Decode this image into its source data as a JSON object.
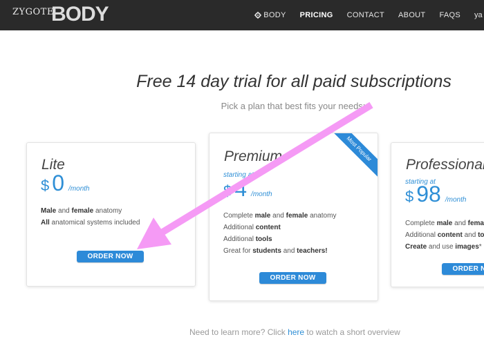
{
  "nav": {
    "logo_zygote": "ZYGOTE",
    "logo_body": "BODY",
    "items": [
      {
        "label": "BODY",
        "icon": "gear-icon"
      },
      {
        "label": "PRICING",
        "active": true
      },
      {
        "label": "CONTACT"
      },
      {
        "label": "ABOUT"
      },
      {
        "label": "FAQS"
      }
    ],
    "user_partial": "ya"
  },
  "headline": "Free 14 day trial for all paid subscriptions",
  "subline": "Pick a plan that best fits your needs:",
  "plans": [
    {
      "name": "Lite",
      "currency": "$",
      "amount": "0",
      "period": "/month",
      "features": [
        [
          {
            "b": "Male"
          },
          {
            "t": " and "
          },
          {
            "b": "female"
          },
          {
            "t": " anatomy"
          }
        ],
        [
          {
            "b": "All"
          },
          {
            "t": " anatomical systems included"
          }
        ]
      ],
      "button": "ORDER NOW"
    },
    {
      "name": "Premium",
      "starting": "starting at",
      "currency": "$",
      "amount": "4",
      "period": "/month",
      "badge": "Most Popular",
      "features": [
        [
          {
            "t": "Complete "
          },
          {
            "b": "male"
          },
          {
            "t": " and "
          },
          {
            "b": "female"
          },
          {
            "t": " anatomy"
          }
        ],
        [
          {
            "t": "Additional "
          },
          {
            "b": "content"
          }
        ],
        [
          {
            "t": "Additional "
          },
          {
            "b": "tools"
          }
        ],
        [
          {
            "t": "Great for "
          },
          {
            "b": "students"
          },
          {
            "t": " and "
          },
          {
            "b": "teachers!"
          }
        ]
      ],
      "button": "ORDER NOW"
    },
    {
      "name": "Professional",
      "starting": "starting at",
      "currency": "$",
      "amount": "98",
      "period": "/month",
      "features": [
        [
          {
            "t": "Complete "
          },
          {
            "b": "male"
          },
          {
            "t": " and "
          },
          {
            "b": "female"
          }
        ],
        [
          {
            "t": "Additional "
          },
          {
            "b": "content"
          },
          {
            "t": " and "
          },
          {
            "b": "to"
          }
        ],
        [
          {
            "b": "Create"
          },
          {
            "t": " and use "
          },
          {
            "b": "images"
          },
          {
            "t": "*"
          }
        ]
      ],
      "button": "ORDER NOW"
    }
  ],
  "footer": {
    "before": "Need to learn more? Click ",
    "link": "here",
    "after": " to watch a short overview"
  },
  "colors": {
    "accent": "#2d8ad8",
    "topbar": "#2a2a2a",
    "arrow": "#f59af5"
  }
}
